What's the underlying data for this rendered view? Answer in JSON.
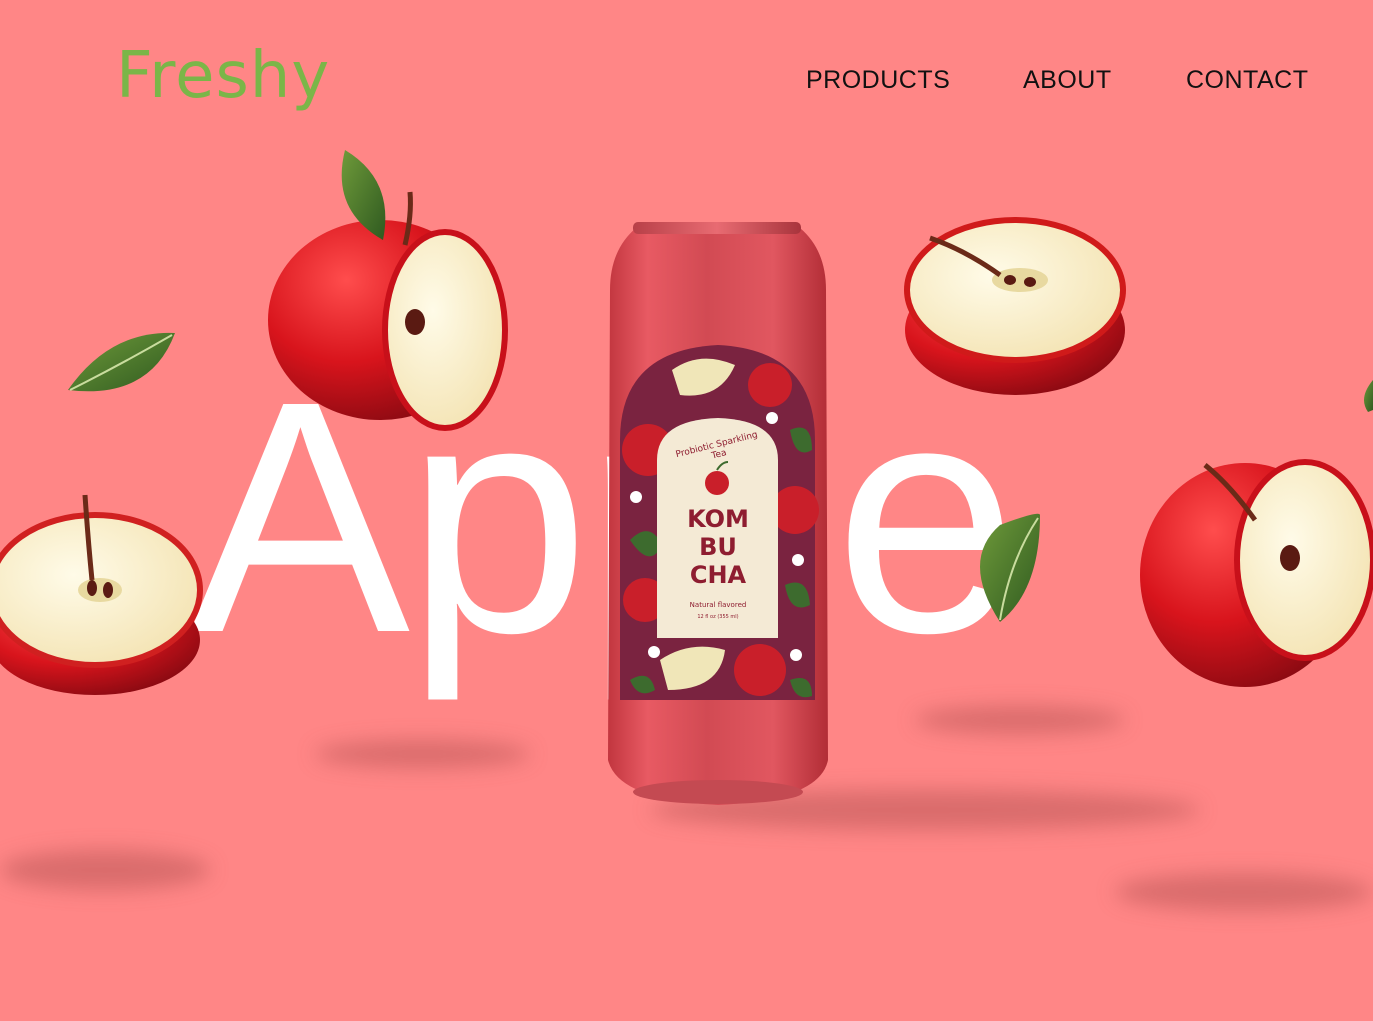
{
  "brand": {
    "logo": "Freshy"
  },
  "nav": {
    "items": [
      {
        "label": "PRODUCTS"
      },
      {
        "label": "ABOUT"
      },
      {
        "label": "CONTACT"
      }
    ]
  },
  "hero": {
    "word": "Apple",
    "product": {
      "tagline": "Probiotic Sparkling Tea",
      "name_line1": "KOM",
      "name_line2": "BU",
      "name_line3": "CHA",
      "flavor_note": "Natural flavored",
      "volume": "12 fl oz (355 ml)"
    }
  },
  "colors": {
    "background": "#ff8686",
    "logo": "#7ab648",
    "hero_text": "#ffffff",
    "can": "#e3535c",
    "label_panel": "#7a2340",
    "label_cream": "#f4ead5",
    "product_name": "#8e1d30"
  }
}
